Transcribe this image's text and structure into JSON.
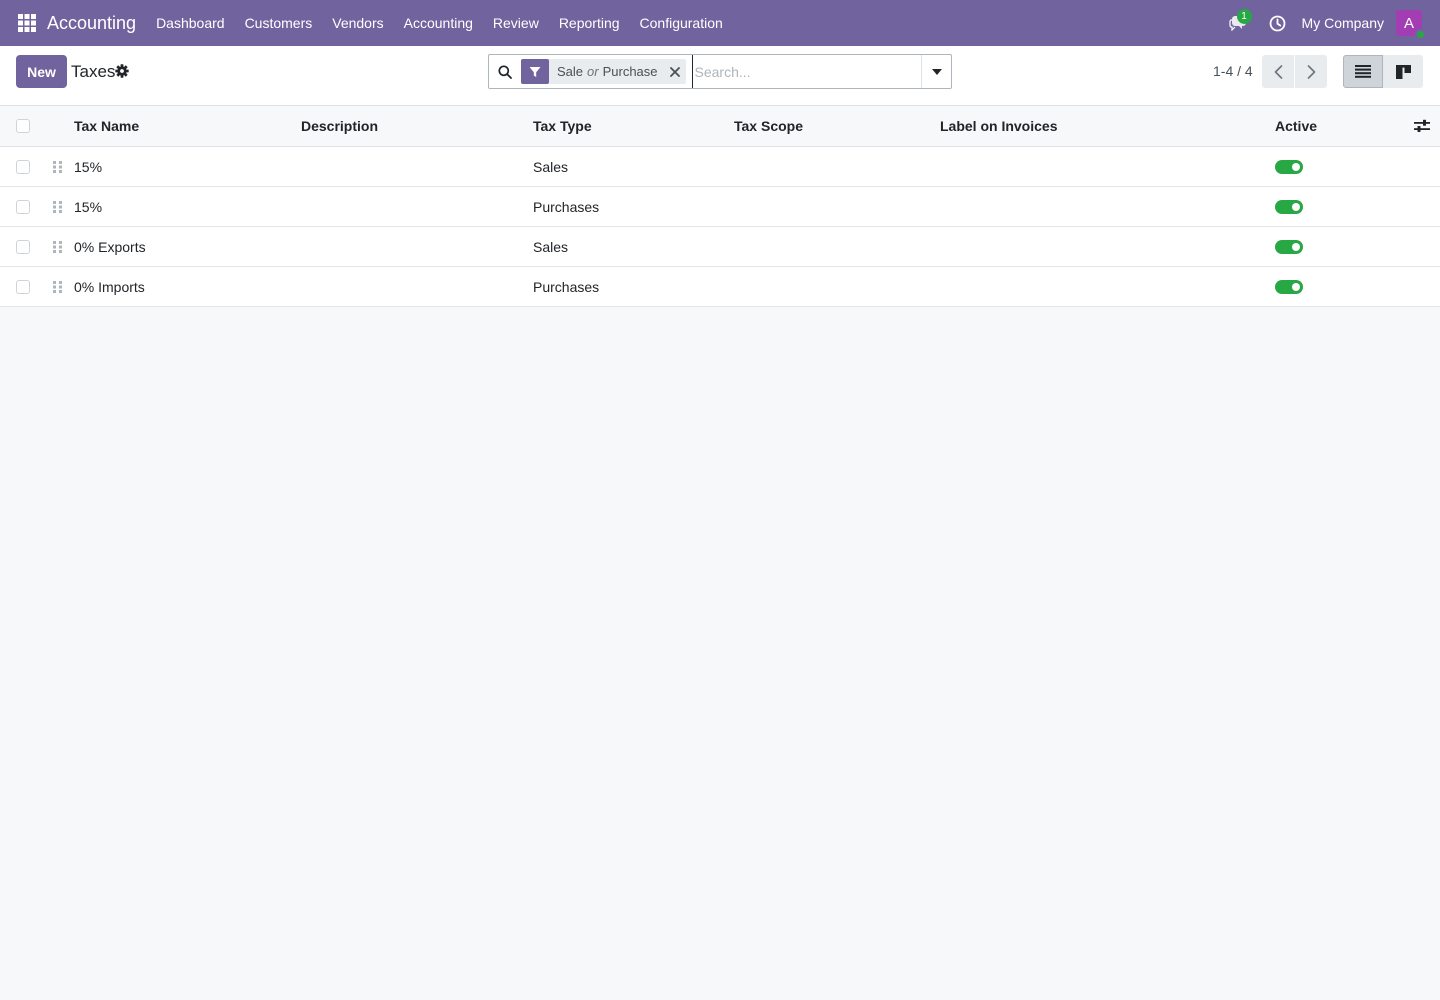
{
  "navbar": {
    "app_name": "Accounting",
    "menu": [
      "Dashboard",
      "Customers",
      "Vendors",
      "Accounting",
      "Review",
      "Reporting",
      "Configuration"
    ],
    "chat_badge": "1",
    "company": "My Company",
    "avatar_letter": "A",
    "color": "#71639e"
  },
  "control_panel": {
    "new_label": "New",
    "title": "Taxes",
    "search": {
      "facet_values": [
        "Sale",
        "Purchase"
      ],
      "facet_separator": "or",
      "placeholder": "Search..."
    },
    "pager": "1-4 / 4"
  },
  "list": {
    "columns": [
      "Tax Name",
      "Description",
      "Tax Type",
      "Tax Scope",
      "Label on Invoices",
      "Active"
    ],
    "rows": [
      {
        "name": "15%",
        "description": "",
        "type": "Sales",
        "scope": "",
        "label": "",
        "active": true
      },
      {
        "name": "15%",
        "description": "",
        "type": "Purchases",
        "scope": "",
        "label": "",
        "active": true
      },
      {
        "name": "0% Exports",
        "description": "",
        "type": "Sales",
        "scope": "",
        "label": "",
        "active": true
      },
      {
        "name": "0% Imports",
        "description": "",
        "type": "Purchases",
        "scope": "",
        "label": "",
        "active": true
      }
    ]
  }
}
